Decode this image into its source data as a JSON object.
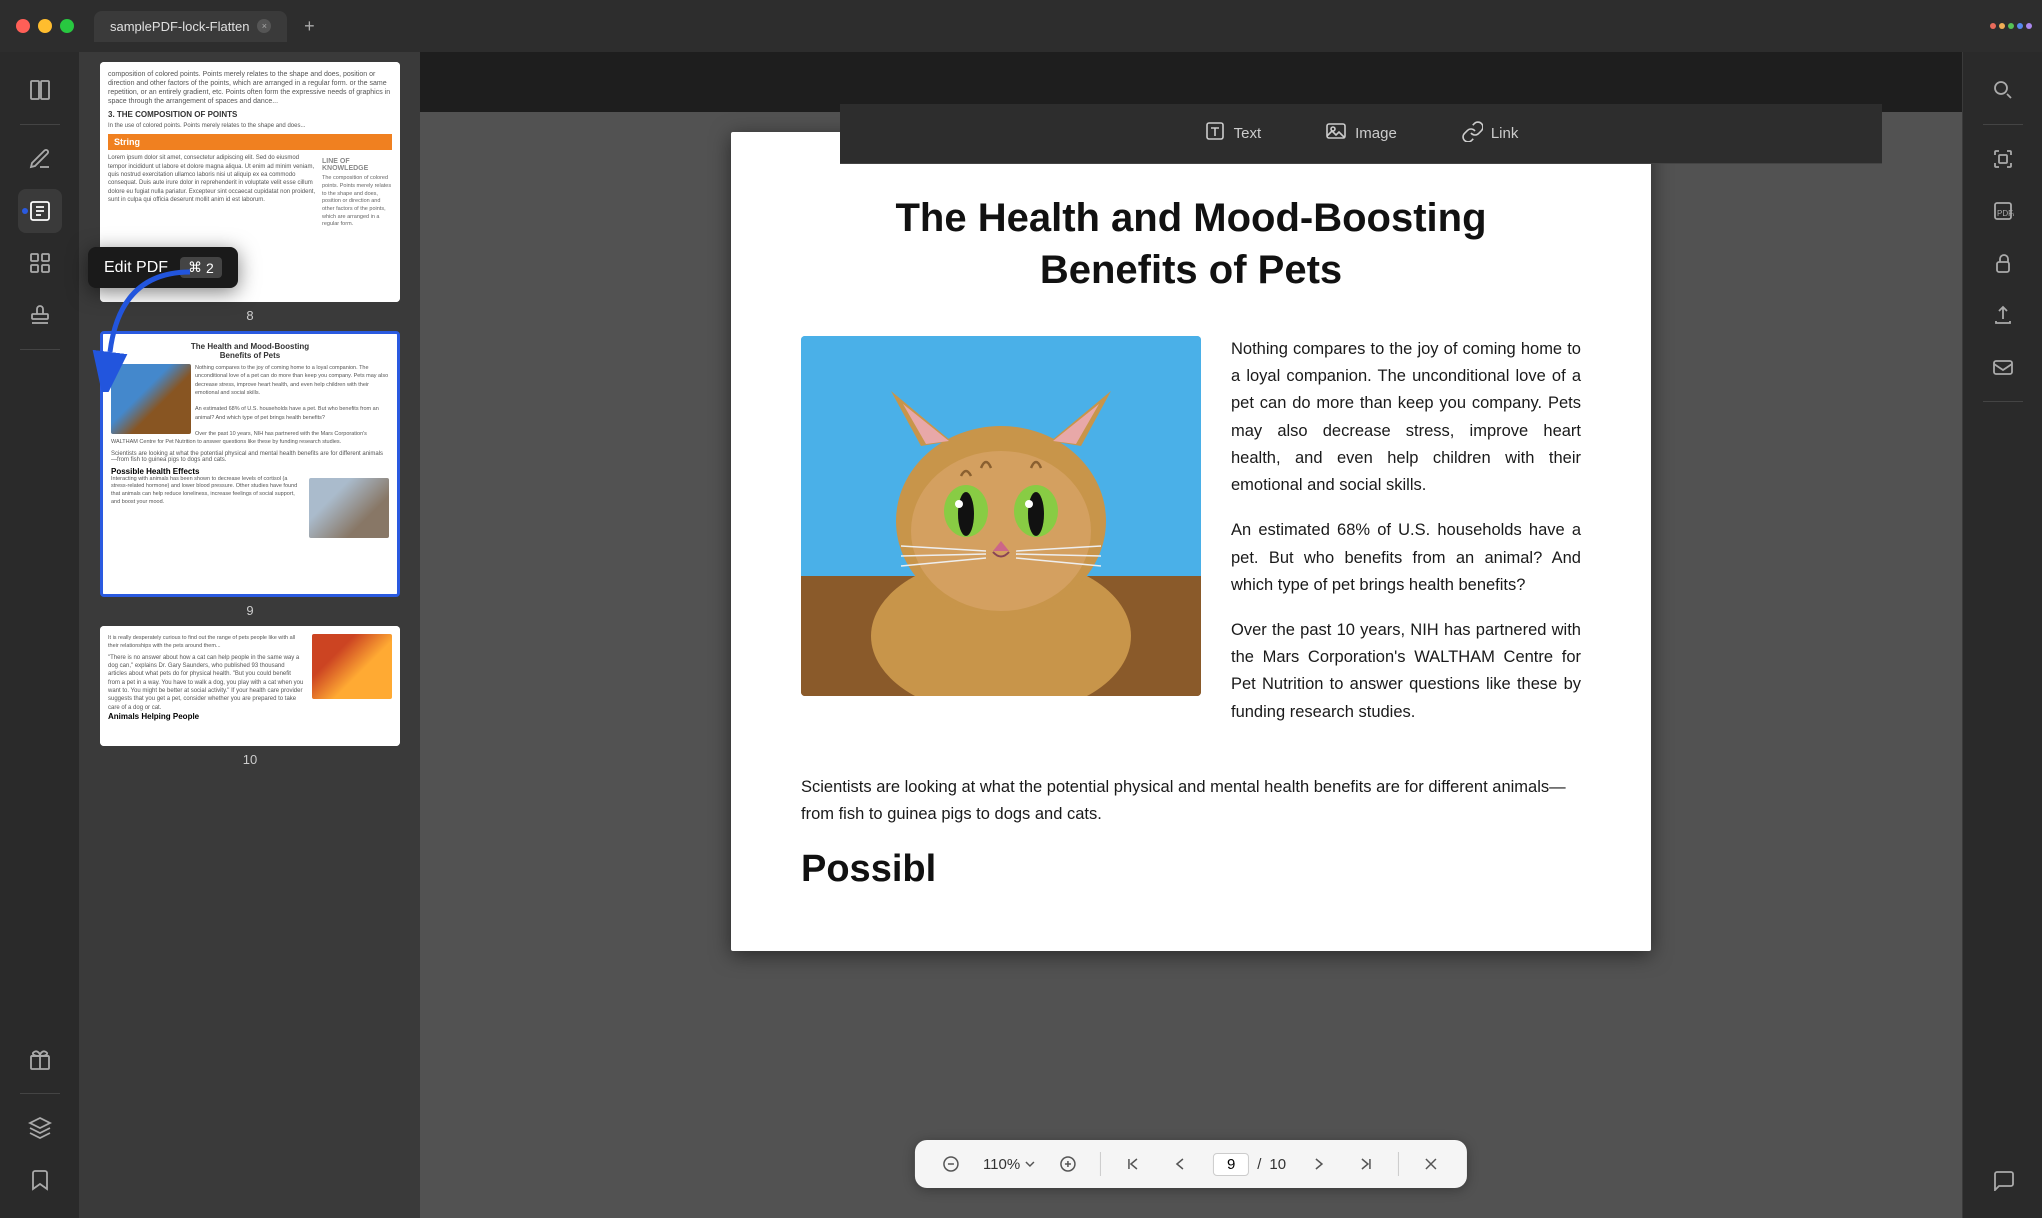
{
  "window": {
    "title": "samplePDF-lock-Flatten",
    "tab_close": "×",
    "tab_add": "+"
  },
  "toolbar": {
    "text_label": "Text",
    "image_label": "Image",
    "link_label": "Link"
  },
  "tooltip": {
    "label": "Edit PDF",
    "shortcut_symbol": "⌘",
    "shortcut_key": "2"
  },
  "sidebar": {
    "icons": [
      "reader-icon",
      "annotate-icon",
      "edit-pdf-icon",
      "organize-icon",
      "stamp-icon",
      "gift-icon",
      "layers-icon",
      "bookmark-icon"
    ]
  },
  "pdf": {
    "page_title_line1": "The Health and Mood-Boosting",
    "page_title_line2": "Benefits of Pets",
    "para1": "Nothing compares to the joy of coming home to a loyal companion. The unconditional love of a pet can do more than keep you company. Pets may also decrease stress, improve heart health,  and  even  help children  with  their emotional and social skills.",
    "para2": "An estimated 68% of U.S. households have a pet. But who benefits from an animal? And which type of pet brings health benefits?",
    "para3": "Over  the  past  10  years,  NIH  has partnered with the Mars Corporation's WALTHAM Centre  for  Pet  Nutrition  to answer  questions  like these by funding research studies.",
    "bottom_para": "Scientists are looking at what the potential physical and mental health benefits are for different animals—from fish to guinea pigs to dogs and cats.",
    "possible_heading": "Possibl"
  },
  "thumbnails": {
    "page8_number": "8",
    "page8_section": "3. THE COMPOSITION OF POINTS",
    "page8_string_label": "String",
    "page9_number": "9",
    "page9_title1": "The Health and Mood-Boosting",
    "page9_title2": "Benefits of Pets",
    "page9_possible": "Possible Health Effects",
    "page10_number": "10",
    "page10_possible": "Animals Helping People"
  },
  "pagination": {
    "zoom_level": "110%",
    "current_page": "9",
    "total_pages": "10",
    "page_separator": "/"
  },
  "right_sidebar": {
    "icons": [
      "search-icon",
      "scan-icon",
      "pdf-a-icon",
      "lock-icon",
      "export-icon",
      "email-icon",
      "comment-icon"
    ]
  }
}
